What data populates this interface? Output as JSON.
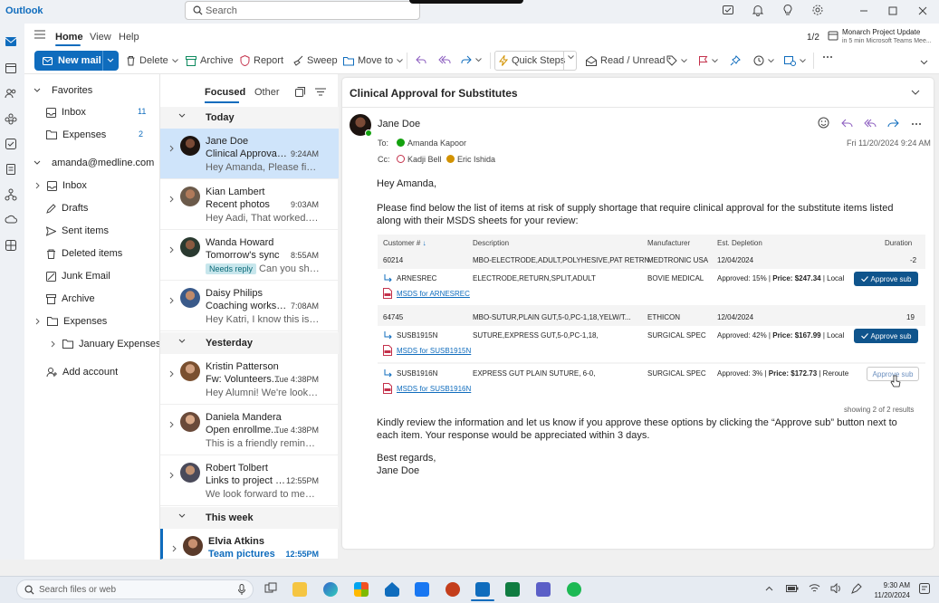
{
  "app": {
    "name": "Outlook"
  },
  "titlebar": {
    "search_placeholder": "Search"
  },
  "ribbon_tabs": [
    "Home",
    "View",
    "Help"
  ],
  "meeting": {
    "counter": "1/2",
    "title": "Monarch Project Update",
    "subtitle": "in 5 min Microsoft Teams Mee..."
  },
  "toolbar": {
    "new_mail": "New mail",
    "delete": "Delete",
    "archive": "Archive",
    "report": "Report",
    "sweep": "Sweep",
    "move_to": "Move to",
    "quick_steps": "Quick Steps",
    "read_unread": "Read / Unread"
  },
  "folders": {
    "favorites_label": "Favorites",
    "favorites": [
      {
        "label": "Inbox",
        "count": "11"
      },
      {
        "label": "Expenses",
        "count": "2"
      }
    ],
    "account": "amanda@medline.com",
    "items": [
      "Inbox",
      "Drafts",
      "Sent items",
      "Deleted items",
      "Junk Email",
      "Archive",
      "Expenses",
      "January Expenses"
    ],
    "add_account": "Add account"
  },
  "message_list": {
    "tabs": [
      "Focused",
      "Other"
    ],
    "groups": [
      "Today",
      "Yesterday",
      "This week"
    ],
    "messages": [
      {
        "from": "Jane Doe",
        "subject": "Clinical Approval f...",
        "time": "9:24AM",
        "preview": "Hey Amanda, Please find b..."
      },
      {
        "from": "Kian Lambert",
        "subject": "Recent photos",
        "time": "9:03AM",
        "preview": "Hey Aadi, That worked. Tha..."
      },
      {
        "from": "Wanda Howard",
        "subject": "Tomorrow's sync",
        "time": "8:55AM",
        "badge": "Needs reply",
        "preview": "Can you shar..."
      },
      {
        "from": "Daisy Philips",
        "subject": "Coaching workshop",
        "time": "7:08AM",
        "preview": "Hey Katri, I know this is last..."
      },
      {
        "from": "Kristin Patterson",
        "subject": "Fw: Volunteers...",
        "time": "Tue 4:38PM",
        "preview": "Hey Alumni! We're looking..."
      },
      {
        "from": "Daniela Mandera",
        "subject": "Open enrollme...",
        "time": "Tue 4:38PM",
        "preview": "This is a friendly reminder t..."
      },
      {
        "from": "Robert Tolbert",
        "subject": "Links to project m...",
        "time": "12:55PM",
        "preview": "We look forward to meetin..."
      },
      {
        "from": "Elvia Atkins",
        "subject": "Team pictures",
        "time": "12:55PM"
      }
    ]
  },
  "reading": {
    "subject": "Clinical Approval for Substitutes",
    "sender": "Jane Doe",
    "to_label": "To:",
    "to": "Amanda Kapoor",
    "cc_label": "Cc:",
    "cc": [
      "Kadji Bell",
      "Eric Ishida"
    ],
    "date": "Fri 11/20/2024 9:24 AM",
    "greeting": "Hey Amanda,",
    "intro": "Please find below the list of items at risk of supply shortage that require clinical approval for the substitute items listed along with their MSDS sheets for your review:",
    "table": {
      "headers": [
        "Customer #",
        "Description",
        "Manufacturer",
        "Est. Depletion",
        "Duration"
      ],
      "groups": [
        {
          "id": "60214",
          "desc": "MBO-ELECTRODE,ADULT,POLYHESIVE,PAT RETRN",
          "mfr": "MEDTRONIC USA",
          "date": "12/04/2024",
          "duration": "-2",
          "subs": [
            {
              "id": "ARNESREC",
              "desc": "ELECTRODE,RETURN,SPLIT,ADULT",
              "mfr": "BOVIE MEDICAL",
              "approved": "Approved: 15% | ",
              "price_label": "Price: $247.34",
              "suffix": " | Local",
              "msds": "MSDS for ARNESREC",
              "action": "Approve sub"
            }
          ]
        },
        {
          "id": "64745",
          "desc": "MBO-SUTUR,PLAIN GUT,5-0,PC-1,18,YELW/T...",
          "mfr": "ETHICON",
          "date": "12/04/2024",
          "duration": "19",
          "subs": [
            {
              "id": "SUSB1915N",
              "desc": "SUTURE,EXPRESS GUT,5-0,PC-1,18,",
              "mfr": "SURGICAL SPEC",
              "approved": "Approved: 42% | ",
              "price_label": "Price: $167.99",
              "suffix": " | Local",
              "msds": "MSDS for SUSB1915N",
              "action": "Approve sub"
            },
            {
              "id": "SUSB1916N",
              "desc": "EXPRESS GUT PLAIN SUTURE, 6-0,",
              "mfr": "SURGICAL SPEC",
              "approved": "Approved: 3% | ",
              "price_label": "Price: $172.73",
              "suffix": " | Reroute",
              "msds": "MSDS for SUSB1916N",
              "action": "Approve sub"
            }
          ]
        }
      ],
      "footer": "showing 2 of 2 results"
    },
    "closing": "Kindly review the information and let us know if you approve these options by clicking the “Approve sub” button next to each item. Your response would be appreciated within 3 days.",
    "signoff": "Best regards,",
    "signature": "Jane Doe"
  },
  "taskbar": {
    "search_placeholder": "Search files or web",
    "time": "9:30 AM",
    "date": "11/20/2024"
  },
  "colors": {
    "accent": "#0f6cbd",
    "selected": "#cfe4fa",
    "approve": "#0f548c",
    "badge_bg": "#c7e6ec"
  }
}
